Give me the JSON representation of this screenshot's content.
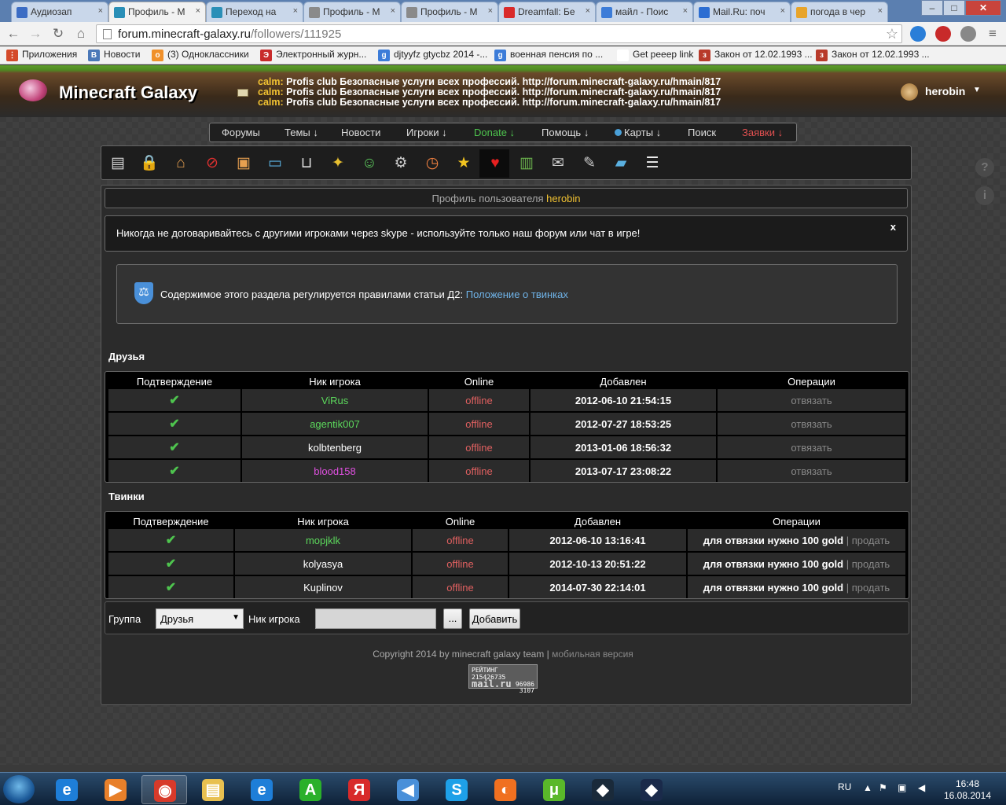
{
  "browser": {
    "tabs": [
      {
        "title": "Аудиозап",
        "color": "#3b6cc4"
      },
      {
        "title": "Профиль - М",
        "color": "#2a8fb7"
      },
      {
        "title": "Переход на",
        "color": "#2a8fb7"
      },
      {
        "title": "Профиль - М",
        "color": "#8a8a8a"
      },
      {
        "title": "Профиль - М",
        "color": "#8a8a8a"
      },
      {
        "title": "Dreamfall: Бе",
        "color": "#d92a2a"
      },
      {
        "title": "майл - Поис",
        "color": "#3c7cd8"
      },
      {
        "title": "Mail.Ru: поч",
        "color": "#2d6ed2"
      },
      {
        "title": "погода в чер",
        "color": "#e8a42a"
      }
    ],
    "window_buttons": [
      "–",
      "□",
      "✕"
    ],
    "url_host": "forum.minecraft-galaxy.ru",
    "url_path": "/followers/111925",
    "bookmarks": [
      {
        "label": "Приложения",
        "color": "#d44a2a",
        "glyph": "⋮"
      },
      {
        "label": "Новости",
        "color": "#4a78b8",
        "glyph": "В"
      },
      {
        "label": "(3) Одноклассники",
        "color": "#f0902a",
        "glyph": "о"
      },
      {
        "label": "Электронный журн...",
        "color": "#c82a2a",
        "glyph": "Э"
      },
      {
        "label": "djtyyfz gtycbz 2014 -...",
        "color": "#3c7cd8",
        "glyph": "g"
      },
      {
        "label": "военная пенсия по ...",
        "color": "#3c7cd8",
        "glyph": "g"
      },
      {
        "label": "Get peeep link",
        "color": "#ffffff",
        "glyph": ""
      },
      {
        "label": "Закон от 12.02.1993 ...",
        "color": "#b83a2a",
        "glyph": "з"
      },
      {
        "label": "Закон от 12.02.1993 ...",
        "color": "#b83a2a",
        "glyph": "з"
      }
    ]
  },
  "header": {
    "logo": "Minecraft Galaxy",
    "ticker": [
      {
        "who": "calm:",
        "text": "Profis club Безопасные услуги всех профессий. http://forum.minecraft-galaxy.ru/hmain/817"
      },
      {
        "who": "calm:",
        "text": "Profis club Безопасные услуги всех профессий. http://forum.minecraft-galaxy.ru/hmain/817"
      },
      {
        "who": "calm:",
        "text": "Profis club Безопасные услуги всех профессий. http://forum.minecraft-galaxy.ru/hmain/817"
      }
    ],
    "username": "herobin",
    "user_arrow": "▼"
  },
  "menu": {
    "forums": "Форумы",
    "topics": "Темы ↓",
    "news": "Новости",
    "players": "Игроки ↓",
    "donate": "Donate ↓",
    "help": "Помощь ↓",
    "maps": "Карты ↓",
    "search": "Поиск",
    "orders": "Заявки ↓"
  },
  "toolbar_icons": [
    {
      "name": "profile-card-icon",
      "glyph": "▤",
      "color": "#d8d8d8"
    },
    {
      "name": "lock-icon",
      "glyph": "🔒",
      "color": "#cccccc"
    },
    {
      "name": "home-icon",
      "glyph": "⌂",
      "color": "#e8a050"
    },
    {
      "name": "ban-icon",
      "glyph": "⊘",
      "color": "#e03030"
    },
    {
      "name": "picture-icon",
      "glyph": "▣",
      "color": "#e8a050"
    },
    {
      "name": "landscape-icon",
      "glyph": "▭",
      "color": "#5ab0e0"
    },
    {
      "name": "cart-icon",
      "glyph": "⊔",
      "color": "#dddddd"
    },
    {
      "name": "medal-icon",
      "glyph": "✦",
      "color": "#e8c030"
    },
    {
      "name": "user-icon",
      "glyph": "☺",
      "color": "#5cc85c"
    },
    {
      "name": "gear-icon",
      "glyph": "⚙",
      "color": "#cccccc"
    },
    {
      "name": "alarm-clock-icon",
      "glyph": "◷",
      "color": "#f08040"
    },
    {
      "name": "star-icon",
      "glyph": "★",
      "color": "#f2c420"
    },
    {
      "name": "heart-icon",
      "glyph": "♥",
      "color": "#e82020"
    },
    {
      "name": "bar-chart-icon",
      "glyph": "▥",
      "color": "#6ab04c"
    },
    {
      "name": "envelope-icon",
      "glyph": "✉",
      "color": "#cccccc"
    },
    {
      "name": "edit-icon",
      "glyph": "✎",
      "color": "#cccccc"
    },
    {
      "name": "folder-icon",
      "glyph": "▰",
      "color": "#5ab0e0"
    },
    {
      "name": "notepad-icon",
      "glyph": "☰",
      "color": "#eeeeee"
    }
  ],
  "side_icons": {
    "help": "?",
    "info": "i"
  },
  "profile": {
    "title_prefix": "Профиль пользователя",
    "username": "herobin"
  },
  "warning": {
    "text": "Никогда не договаривайтесь с другими игроками через skype - используйте только наш форум или чат в игре!",
    "close": "x"
  },
  "rule": {
    "text": "Содержимое этого раздела регулируется правилами статьи Д2:",
    "link": "Положение о твинках"
  },
  "friends": {
    "title": "Друзья",
    "columns": [
      "Подтверждение",
      "Ник игрока",
      "Online",
      "Добавлен",
      "Операции"
    ],
    "rows": [
      {
        "confirmed": "✔",
        "nick": "ViRus",
        "nick_color": "#5cd85c",
        "online": "offline",
        "added": "2012-06-10 21:54:15",
        "op": "отвязать"
      },
      {
        "confirmed": "✔",
        "nick": "agentik007",
        "nick_color": "#5cd85c",
        "online": "offline",
        "added": "2012-07-27 18:53:25",
        "op": "отвязать"
      },
      {
        "confirmed": "✔",
        "nick": "kolbtenberg",
        "nick_color": "#ffffff",
        "online": "offline",
        "added": "2013-01-06 18:56:32",
        "op": "отвязать"
      },
      {
        "confirmed": "✔",
        "nick": "blood158",
        "nick_color": "#e050e0",
        "online": "offline",
        "added": "2013-07-17 23:08:22",
        "op": "отвязать"
      }
    ]
  },
  "twinks": {
    "title": "Твинки",
    "columns": [
      "Подтверждение",
      "Ник игрока",
      "Online",
      "Добавлен",
      "Операции"
    ],
    "rows": [
      {
        "confirmed": "✔",
        "nick": "mopjklk",
        "nick_color": "#5cd85c",
        "online": "offline",
        "added": "2012-06-10 13:16:41",
        "op": "для отвязки нужно 100 gold",
        "sep": "|",
        "sell": "продать"
      },
      {
        "confirmed": "✔",
        "nick": "kolyasya",
        "nick_color": "#ffffff",
        "online": "offline",
        "added": "2012-10-13 20:51:22",
        "op": "для отвязки нужно 100 gold",
        "sep": "|",
        "sell": "продать"
      },
      {
        "confirmed": "✔",
        "nick": "Kuplinov",
        "nick_color": "#ffffff",
        "online": "offline",
        "added": "2014-07-30 22:14:01",
        "op": "для отвязки нужно 100 gold",
        "sep": "|",
        "sell": "продать"
      }
    ]
  },
  "add_form": {
    "group_label": "Группа",
    "group_value": "Друзья",
    "nick_label": "Ник игрока",
    "nick_value": "",
    "browse": "...",
    "submit": "Добавить"
  },
  "footer": {
    "copyright": "Copyright 2014 by minecraft galaxy team",
    "sep": "|",
    "mobile": "мобильная версия",
    "counter_label": "РЕЙТИНГ",
    "counter_id": "215426735",
    "counter_brand": "mail.ru",
    "counter_v1": "96986",
    "counter_v2": "3107"
  },
  "taskbar": {
    "apps": [
      {
        "name": "internet-explorer-icon",
        "glyph": "e",
        "color": "#1e7ed8",
        "active": false
      },
      {
        "name": "media-player-icon",
        "glyph": "▶",
        "color": "#e8802a",
        "active": false
      },
      {
        "name": "chrome-icon",
        "glyph": "◉",
        "color": "#d83a2a",
        "active": true
      },
      {
        "name": "file-explorer-icon",
        "glyph": "▤",
        "color": "#e8c050",
        "active": false
      },
      {
        "name": "internet-explorer-2-icon",
        "glyph": "e",
        "color": "#1e7ed8",
        "active": false
      },
      {
        "name": "arena-icon",
        "glyph": "A",
        "color": "#2ab02a",
        "active": false
      },
      {
        "name": "yandex-icon",
        "glyph": "Я",
        "color": "#d82a2a",
        "active": false
      },
      {
        "name": "speaker-icon",
        "glyph": "◀",
        "color": "#4a90d9",
        "active": false
      },
      {
        "name": "skype-icon",
        "glyph": "S",
        "color": "#1ea0e8",
        "active": false
      },
      {
        "name": "origin-icon",
        "glyph": "◐",
        "color": "#f07020",
        "active": false
      },
      {
        "name": "utorrent-icon",
        "glyph": "μ",
        "color": "#5ab82a",
        "active": false
      },
      {
        "name": "game-launcher-icon",
        "glyph": "◆",
        "color": "#1a2a3a",
        "active": false
      },
      {
        "name": "game-launcher-2-icon",
        "glyph": "◆",
        "color": "#1a2a4a",
        "active": false
      }
    ],
    "lang": "RU",
    "time": "16:48",
    "date": "16.08.2014"
  }
}
